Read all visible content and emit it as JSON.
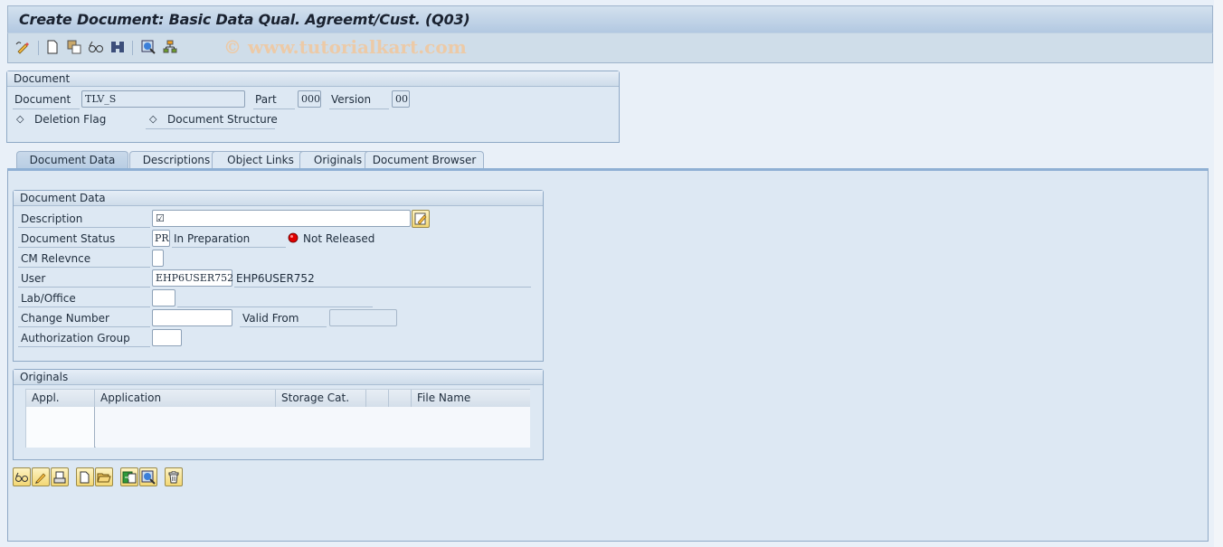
{
  "window": {
    "title": "Create Document: Basic Data Qual. Agreemt/Cust. (Q03)",
    "watermark": "© www.tutorialkart.com"
  },
  "toolbar": {
    "icons": [
      "change-display-icon",
      "new-document-icon",
      "copy-document-icon",
      "display-icon",
      "find-icon",
      "zoom-detail-icon",
      "hierarchy-icon"
    ]
  },
  "document_header": {
    "group_title": "Document",
    "document_label": "Document",
    "document_value": "TLV_S",
    "part_label": "Part",
    "part_value": "000",
    "version_label": "Version",
    "version_value": "00",
    "deletion_flag_label": "Deletion Flag",
    "document_structure_label": "Document Structure"
  },
  "tabs": [
    {
      "label": "Document Data",
      "active": true
    },
    {
      "label": "Descriptions",
      "active": false
    },
    {
      "label": "Object Links",
      "active": false
    },
    {
      "label": "Originals",
      "active": false
    },
    {
      "label": "Document Browser",
      "active": false
    }
  ],
  "document_data": {
    "group_title": "Document Data",
    "description_label": "Description",
    "description_value": "",
    "doc_status_label": "Document Status",
    "doc_status_code": "PR",
    "doc_status_text": "In Preparation",
    "release_status_text": "Not Released",
    "release_status_color": "#d40000",
    "cm_relevance_label": "CM Relevnce",
    "cm_relevance_value": "",
    "user_label": "User",
    "user_value": "EHP6USER752",
    "user_text": "EHP6USER752",
    "lab_office_label": "Lab/Office",
    "lab_office_value": "",
    "change_number_label": "Change Number",
    "change_number_value": "",
    "valid_from_label": "Valid From",
    "valid_from_value": "",
    "auth_group_label": "Authorization Group",
    "auth_group_value": ""
  },
  "originals": {
    "group_title": "Originals",
    "columns": [
      "Appl.",
      "Application",
      "Storage Cat.",
      "",
      "",
      "File Name"
    ],
    "rows": []
  },
  "originals_buttons": [
    "display-original-icon",
    "change-original-icon",
    "print-original-icon",
    "create-original-icon",
    "open-original-icon",
    "check-in-icon",
    "detail-view-icon",
    "delete-original-icon"
  ],
  "colors": {
    "title_gradient_top": "#d3e1ee",
    "panel_bg": "#dde8f3",
    "button_yellow": "#f3d774"
  }
}
